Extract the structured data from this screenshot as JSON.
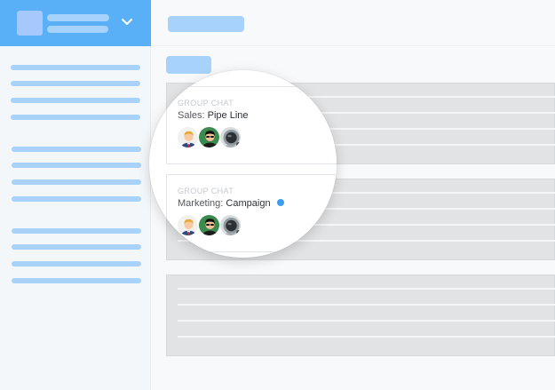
{
  "sidebar": {
    "header": {
      "chevron_icon": "chevron-down-icon"
    }
  },
  "chats": [
    {
      "label": "GROUP CHAT",
      "dept": "Sales:",
      "name": "Pipe Line",
      "unread": false,
      "members": [
        "businessman-avatar",
        "person-with-sunglasses-avatar",
        "astronaut-avatar"
      ]
    },
    {
      "label": "GROUP CHAT",
      "dept": "Marketing:",
      "name": "Campaign",
      "unread": true,
      "members": [
        "businessman-avatar",
        "person-with-sunglasses-avatar",
        "astronaut-avatar"
      ]
    }
  ],
  "colors": {
    "header_blue": "#5ab0f6",
    "placeholder_blue": "#a6d2fb",
    "unread_dot": "#3d9ef0"
  }
}
